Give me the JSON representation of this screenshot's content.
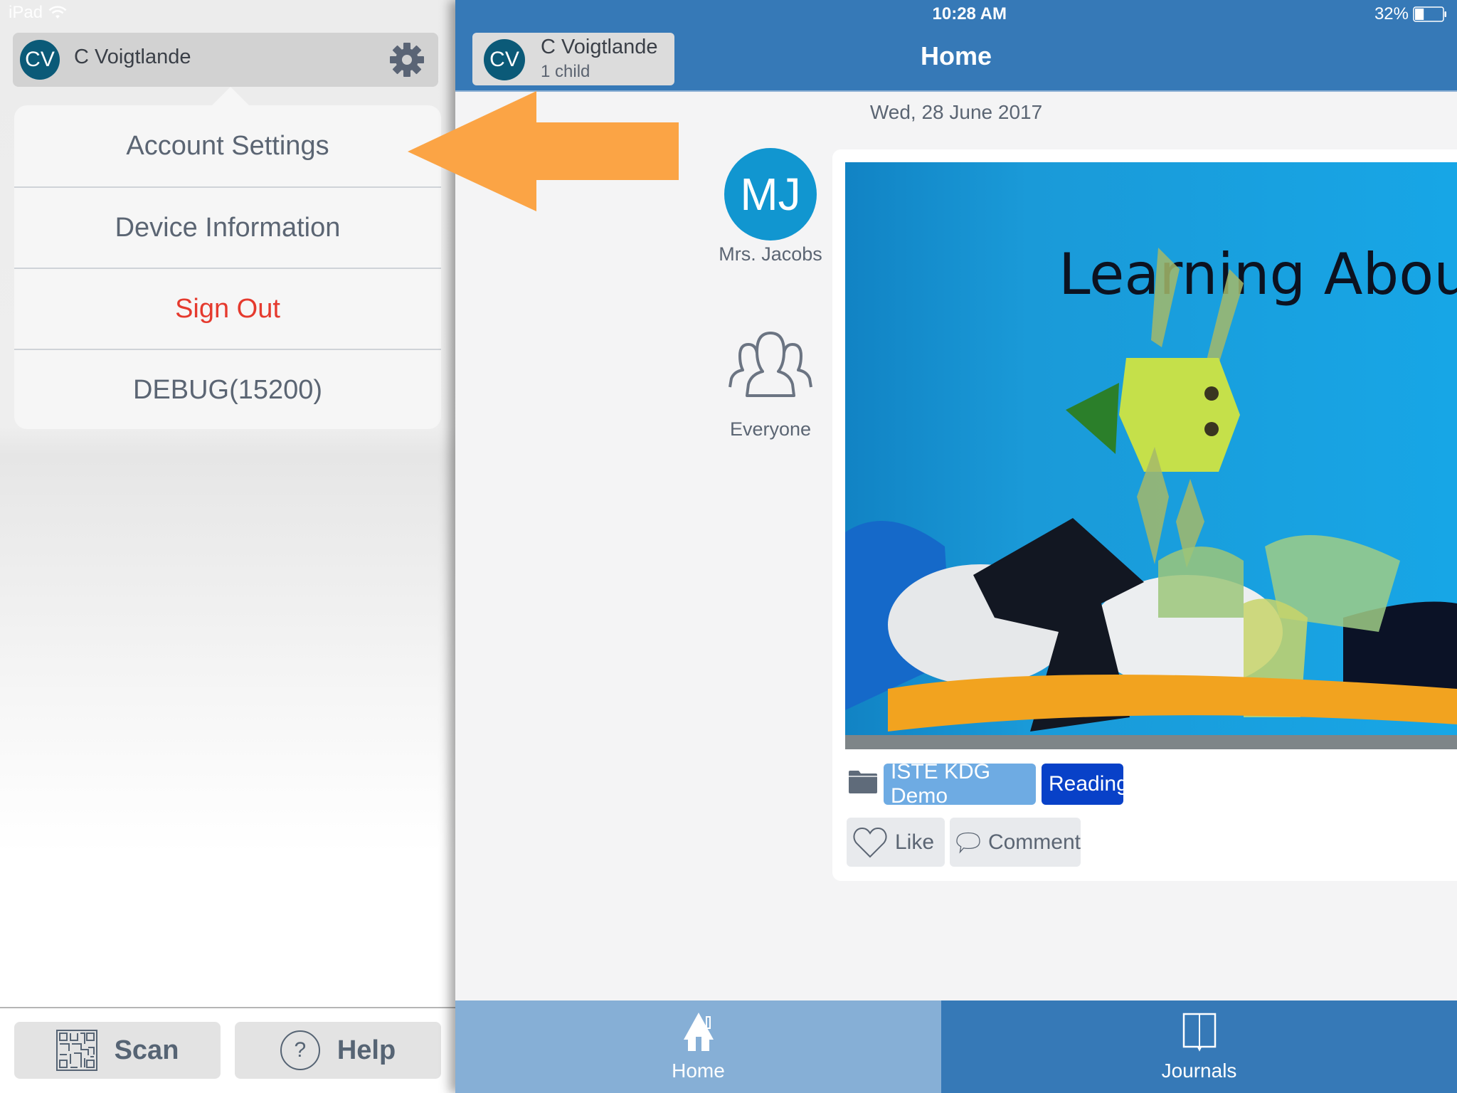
{
  "status_bar": {
    "device": "iPad",
    "time": "10:28 AM",
    "battery": "32%",
    "battery_level": 0.32
  },
  "account_panel": {
    "avatar_initials": "CV",
    "user_name": "C Voigtlande",
    "settings_icon": "gear-icon",
    "menu_items": [
      {
        "label": "Account Settings"
      },
      {
        "label": "Device Information"
      },
      {
        "label": "Sign Out"
      },
      {
        "label": "DEBUG(15200)"
      }
    ],
    "bottom_buttons": {
      "scan": "Scan",
      "help": "Help",
      "help_glyph": "?"
    }
  },
  "header": {
    "child_selector": {
      "initials": "CV",
      "name": "C Voigtlande",
      "subtitle": "1 child"
    },
    "title": "Home"
  },
  "feed": {
    "date": "Wed, 28 June 2017",
    "post": {
      "author_initials": "MJ",
      "author_name": "Mrs. Jacobs",
      "audience": "Everyone",
      "photo_text": "Learning About",
      "tags": [
        "ISTE KDG Demo",
        "Reading"
      ],
      "actions": {
        "like": "Like",
        "comment": "Comment"
      }
    }
  },
  "tabs": [
    {
      "label": "Home",
      "icon": "house-icon",
      "active": true
    },
    {
      "label": "Journals",
      "icon": "book-icon",
      "active": false
    }
  ],
  "colors": {
    "header_blue": "#3679b7",
    "active_tab": "#86afd6",
    "avatar_dark": "#0b5a78",
    "author_avatar": "#1196d0",
    "sign_out_red": "#e53a2e",
    "tag_light": "#6eabe3",
    "tag_dark": "#0841c8",
    "annotation_orange": "#fba445"
  }
}
